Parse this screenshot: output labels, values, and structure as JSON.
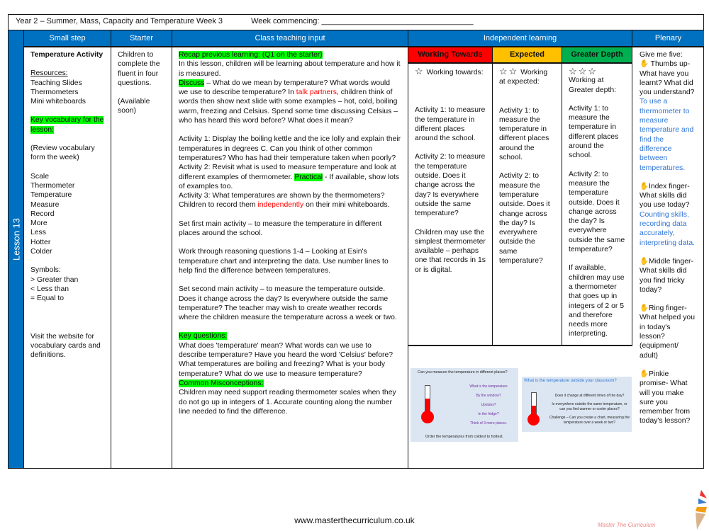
{
  "header": {
    "title": "Year 2 – Summer, Mass, Capacity and Temperature Week 3",
    "week_commencing": "Week commencing: ___________________________________"
  },
  "lesson": "Lesson 13",
  "columns": {
    "small_step": "Small step",
    "starter": "Starter",
    "teaching": "Class teaching input",
    "independent": "Independent learning",
    "plenary": "Plenary"
  },
  "small_step": {
    "title": "Temperature Activity",
    "resources_label": "Resources:",
    "resources": [
      "Teaching Slides",
      "Thermometers",
      "Mini whiteboards"
    ],
    "vocab_label": "Key vocabulary for the lesson:",
    "review": "(Review vocabulary form the week)",
    "vocab": [
      "Scale",
      "Thermometer",
      "Temperature",
      "Measure",
      "Record",
      "More",
      "Less",
      "Hotter",
      "Colder"
    ],
    "symbols_label": "Symbols:",
    "symbols": [
      "> Greater than",
      "< Less than",
      "= Equal to"
    ],
    "visit": "Visit the website for vocabulary cards and definitions."
  },
  "starter": {
    "text": "Children to complete the fluent in four questions.",
    "available": "(Available soon)"
  },
  "teaching": {
    "recap": "Recap previous learning: (Q1 on the starter)",
    "intro": "In this lesson, children will be learning about temperature and how it is measured.",
    "discuss_label": "Discuss",
    "discuss_a": " – What do we mean by temperature? What words would we use to describe temperature? In ",
    "talk": "talk partners",
    "discuss_b": ", children think of words then show next slide with some examples – hot, cold, boiling warm, freezing and Celsius. Spend some time discussing Celsius – who has heard this word before? What does it mean?",
    "act1": "Activity 1: Display the boiling kettle and the ice lolly and explain their temperatures in degrees C. Can you think of other common temperatures? Who has had their temperature taken when poorly?",
    "act2_a": "Activity 2: Revisit what is used to measure temperature and look at different examples of thermometer. ",
    "practical": "Practical",
    "act2_b": " - If available, show lots of examples too.",
    "act3_a": "Activity 3: What temperatures are shown by the thermometers? Children to record them ",
    "independently": "independently",
    "act3_b": " on their mini whiteboards.",
    "first_main": "Set first main activity – to measure the temperature in different places around the school.",
    "reasoning": "Work through reasoning questions 1-4 – Looking at Esin's temperature chart and interpreting the data. Use number lines to help find the difference between temperatures.",
    "second_main": "Set second main activity – to measure the temperature outside. Does it change across the day? Is everywhere outside the same temperature? The teacher may wish to create weather records where the children measure the temperature across a week or two.",
    "kq_label": "Key questions:",
    "kq": "What does 'temperature' mean? What words can we use to describe temperature? Have you heard the word 'Celsius' before? What temperatures are boiling and freezing? What is your body temperature? What do we use to measure temperature?",
    "cm_label": "Common Misconceptions:",
    "cm": "Children may need support reading thermometer scales when they do not go up in integers of 1. Accurate counting along the number line needed to find the difference."
  },
  "independent": {
    "wt": {
      "label": "Working Towards",
      "color": "#ff0000",
      "stars": "☆",
      "heading": "Working towards:",
      "a1": "Activity 1:  to measure the temperature in different places around the school.",
      "a2": "Activity 2: to measure the temperature outside. Does it change across the day? Is everywhere outside the same temperature?",
      "note": "Children may use the simplest thermometer available – perhaps one that records in 1s or is digital."
    },
    "ex": {
      "label": "Expected",
      "color": "#ffc000",
      "stars": "☆☆",
      "heading": "Working at expected:",
      "a1": "Activity 1:  to measure the temperature in different places around the school.",
      "a2": "Activity 2: to measure the temperature outside. Does it change across the day? Is everywhere outside the same temperature?"
    },
    "gd": {
      "label": "Greater Depth",
      "color": "#00b050",
      "stars": "☆☆☆",
      "heading": "Working at Greater depth:",
      "a1": "Activity 1:  to measure the temperature in different places around the school.",
      "a2": "Activity 2: to measure the temperature outside. Does it change across the day? Is everywhere outside the same temperature?",
      "note": "If available, children may use a thermometer that goes up in integers of 2 or 5 and therefore needs more interpreting."
    },
    "slide1": {
      "title": "Can you measure the temperature in different places?",
      "lines": [
        "What is the temperature",
        "By the window?",
        "Upstairs?",
        "In the fridge?",
        "Think of 3 more places."
      ],
      "footer": "Order the temperatures from coldest to hottest."
    },
    "slide2": {
      "title": "What is the temperature outside your classroom?",
      "lines": [
        "Does it change at different times of the day?",
        "Is everywhere outside the same temperature, or can you find warmer or cooler places?",
        "Challenge – Can you create a chart, measuring the temperature over a week or two?"
      ]
    }
  },
  "plenary": {
    "intro": "Give me five:",
    "thumb": "Thumbs up- What have you learnt? What did you understand?",
    "thumb_answer": "To use a thermometer to measure temperature and find the difference between temperatures.",
    "index": "Index finger- What skills did you use today?",
    "index_answer": "Counting skills, recording data accurately, interpreting data.",
    "middle": "Middle finger- What skills did you find tricky today?",
    "ring": "Ring finger- What helped you in today's lesson? (equipment/ adult)",
    "pinkie": "Pinkie promise- What will you make sure you remember from today's lesson?"
  },
  "footer": {
    "url": "www.masterthecurriculum.co.uk",
    "logo": "Master The Curriculum"
  }
}
